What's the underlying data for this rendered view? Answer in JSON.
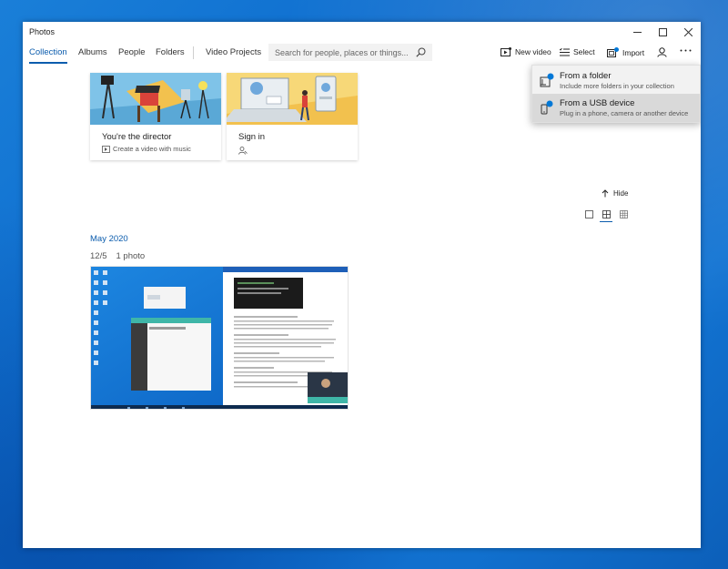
{
  "window": {
    "title": "Photos"
  },
  "tabs": [
    {
      "label": "Collection",
      "active": true
    },
    {
      "label": "Albums"
    },
    {
      "label": "People"
    },
    {
      "label": "Folders"
    },
    {
      "label": "Video Projects"
    }
  ],
  "search": {
    "placeholder": "Search for people, places or things..."
  },
  "toolbar": {
    "new_video_label": "New video",
    "select_label": "Select",
    "import_label": "Import"
  },
  "cards": [
    {
      "title": "You're the director",
      "subtitle": "Create a video with music"
    },
    {
      "title": "Sign in"
    }
  ],
  "hide_label": "Hide",
  "gallery": {
    "month": "May 2020",
    "date": "12/5",
    "count": "1 photo"
  },
  "import_menu": [
    {
      "title": "From a folder",
      "subtitle": "Include more folders in your collection"
    },
    {
      "title": "From a USB device",
      "subtitle": "Plug in a phone, camera or another device"
    }
  ],
  "colors": {
    "accent": "#0b5cad",
    "desktop": "#0f6fd0"
  },
  "icons": [
    "minimize-icon",
    "maximize-icon",
    "close-icon",
    "search-icon",
    "new-video-icon",
    "select-icon",
    "import-icon",
    "account-icon",
    "more-icon",
    "hide-arrow-icon",
    "folder-icon",
    "usb-device-icon"
  ]
}
